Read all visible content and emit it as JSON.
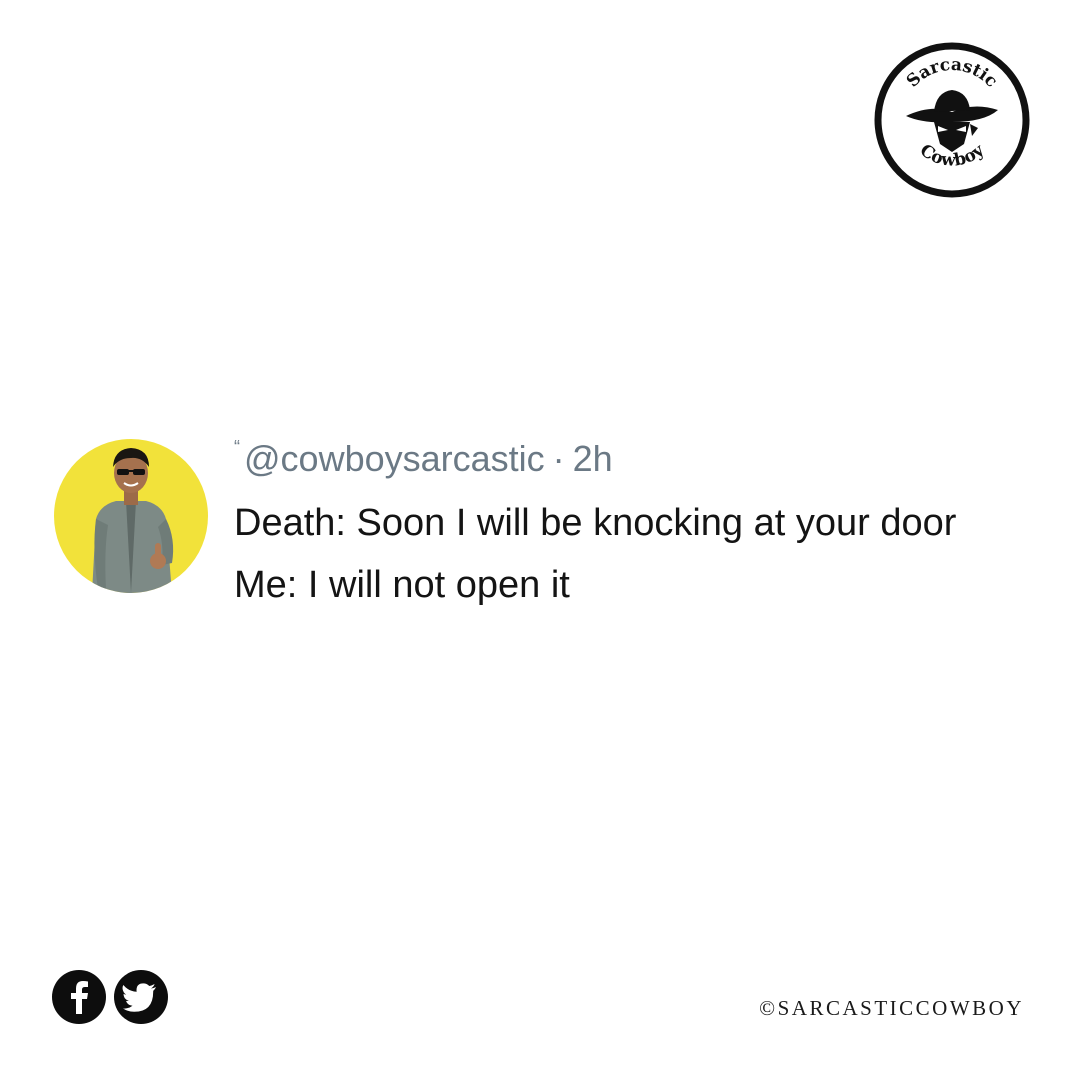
{
  "logo": {
    "text_top": "Sarcastic",
    "text_bottom": "Cowboy"
  },
  "tweet": {
    "avatar_icon": "profile-photo",
    "handle": "@cowboysarcastic",
    "separator": "·",
    "time": "2h",
    "lines": [
      "Death: Soon I will be knocking at your door",
      "Me: I will not open it"
    ]
  },
  "footer": {
    "icons": [
      "facebook-icon",
      "twitter-icon"
    ],
    "copyright": "©SARCASTICCOWBOY"
  },
  "colors": {
    "avatar_background": "#f2e23a",
    "meta_text": "#6b7985",
    "tweet_text": "#141414",
    "icon_fill": "#0d0d0d"
  }
}
